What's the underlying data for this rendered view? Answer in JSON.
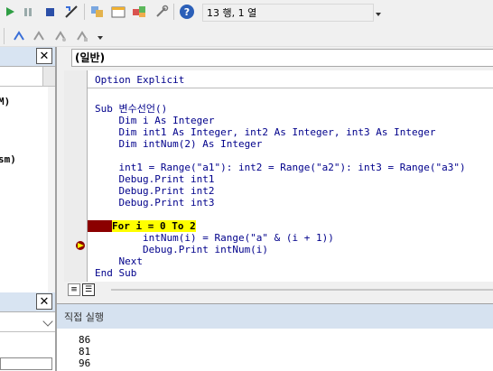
{
  "toolbar": {
    "location": "13 행, 1 열",
    "buttons": [
      "run-icon",
      "pause-icon",
      "stop-icon",
      "design-mode-icon",
      "project-explorer-icon",
      "properties-icon",
      "object-browser-icon",
      "toolbox-icon",
      "help-icon"
    ]
  },
  "toolbar2": {
    "buttons": [
      "indent-icon",
      "outdent-icon",
      "toggle-breakpoint-icon",
      "comment-block-icon"
    ]
  },
  "project_pane": {
    "items": [
      "M)",
      "sm)"
    ]
  },
  "code_window": {
    "object_combo": "(일반)",
    "lines": [
      "Option Explicit",
      "",
      "Sub 변수선언()",
      "    Dim i As Integer",
      "    Dim int1 As Integer, int2 As Integer, int3 As Integer",
      "    Dim intNum(2) As Integer",
      "",
      "    int1 = Range(\"a1\"): int2 = Range(\"a2\"): int3 = Range(\"a3\")",
      "    Debug.Print int1",
      "    Debug.Print int2",
      "    Debug.Print int3",
      "",
      "    For i = 0 To 2",
      "        intNum(i) = Range(\"a\" & (i + 1))",
      "        Debug.Print intNum(i)",
      "    Next",
      "End Sub"
    ],
    "current_line_index": 12
  },
  "immediate": {
    "title": "직접 실행",
    "lines": [
      "86",
      "81",
      "96"
    ]
  },
  "colors": {
    "keyword": "#00008b",
    "highlight": "#ffff00",
    "breakpoint": "#8b0000"
  }
}
